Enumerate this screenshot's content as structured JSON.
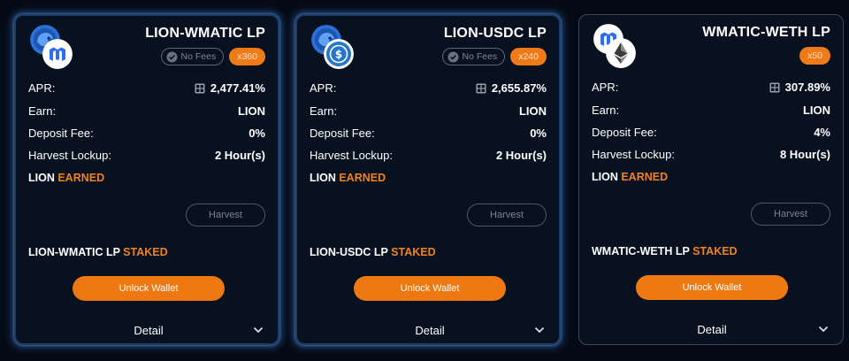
{
  "farms": [
    {
      "pair": "LION-WMATIC LP",
      "show_no_fees": true,
      "no_fees_label": "No Fees",
      "multiplier": "x360",
      "apr_label": "APR:",
      "apr_value": "2,477.41%",
      "earn_label": "Earn:",
      "earn_value": "LION",
      "deposit_fee_label": "Deposit Fee:",
      "deposit_fee_value": "0%",
      "harvest_lockup_label": "Harvest Lockup:",
      "harvest_lockup_value": "2 Hour(s)",
      "earned_token": "LION",
      "earned_word": "EARNED",
      "harvest_button": "Harvest",
      "staked_pair": "LION-WMATIC LP",
      "staked_word": "STAKED",
      "unlock_button": "Unlock Wallet",
      "detail_label": "Detail",
      "token_icons": [
        "lion-token-icon",
        "wmatic-token-icon"
      ]
    },
    {
      "pair": "LION-USDC LP",
      "show_no_fees": true,
      "no_fees_label": "No Fees",
      "multiplier": "x240",
      "apr_label": "APR:",
      "apr_value": "2,655.87%",
      "earn_label": "Earn:",
      "earn_value": "LION",
      "deposit_fee_label": "Deposit Fee:",
      "deposit_fee_value": "0%",
      "harvest_lockup_label": "Harvest Lockup:",
      "harvest_lockup_value": "2 Hour(s)",
      "earned_token": "LION",
      "earned_word": "EARNED",
      "harvest_button": "Harvest",
      "staked_pair": "LION-USDC LP",
      "staked_word": "STAKED",
      "unlock_button": "Unlock Wallet",
      "detail_label": "Detail",
      "token_icons": [
        "lion-token-icon",
        "usdc-token-icon"
      ]
    },
    {
      "pair": "WMATIC-WETH LP",
      "show_no_fees": false,
      "no_fees_label": "",
      "multiplier": "x50",
      "apr_label": "APR:",
      "apr_value": "307.89%",
      "earn_label": "Earn:",
      "earn_value": "LION",
      "deposit_fee_label": "Deposit Fee:",
      "deposit_fee_value": "4%",
      "harvest_lockup_label": "Harvest Lockup:",
      "harvest_lockup_value": "8 Hour(s)",
      "earned_token": "LION",
      "earned_word": "EARNED",
      "harvest_button": "Harvest",
      "staked_pair": "WMATIC-WETH LP",
      "staked_word": "STAKED",
      "unlock_button": "Unlock Wallet",
      "detail_label": "Detail",
      "token_icons": [
        "wmatic-token-icon",
        "weth-token-icon"
      ]
    }
  ],
  "colors": {
    "page_background": "#050b16",
    "card_background": "#08111f",
    "accent_orange": "#ee7913",
    "highlight_text": "#f0821f",
    "glow_border": "#213c63"
  }
}
